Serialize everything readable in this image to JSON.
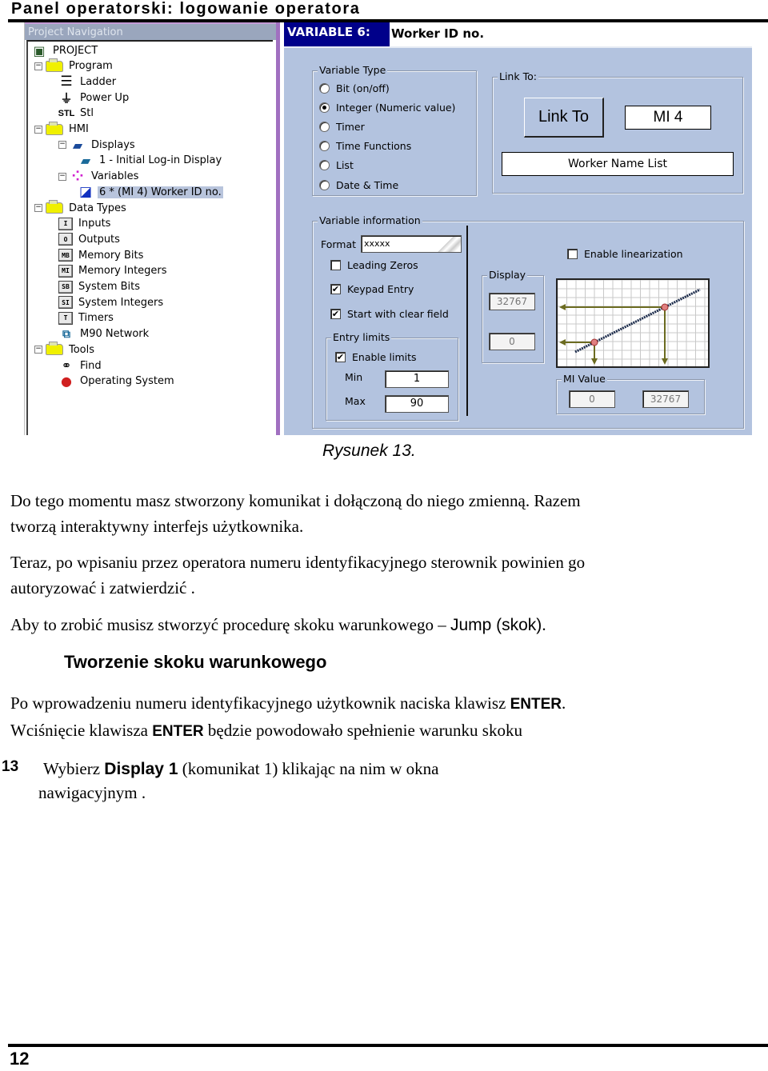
{
  "page": {
    "header": "Panel operatorski: logowanie operatora",
    "page_number": "12"
  },
  "screenshot": {
    "nav": {
      "title": "Project Navigation",
      "items": [
        {
          "label": "PROJECT",
          "icon": "plc-icon"
        },
        {
          "label": "Program",
          "icon": "folder-icon"
        },
        {
          "label": "Ladder",
          "icon": "ladder-icon"
        },
        {
          "label": "Power Up",
          "icon": "plug-icon"
        },
        {
          "label": "Stl",
          "icon": "stl-icon",
          "icon_text": "STL"
        },
        {
          "label": "HMI",
          "icon": "folder-icon"
        },
        {
          "label": "Displays",
          "icon": "displays-icon"
        },
        {
          "label": "1 - Initial Log-in Display",
          "icon": "display-icon"
        },
        {
          "label": "Variables",
          "icon": "variables-icon"
        },
        {
          "label": "6 * (MI 4) Worker ID no.",
          "icon": "variable-icon",
          "selected": true
        },
        {
          "label": "Data Types",
          "icon": "folder-icon"
        },
        {
          "label": "Inputs",
          "icon": "inputs-icon",
          "icon_text": "I"
        },
        {
          "label": "Outputs",
          "icon": "outputs-icon",
          "icon_text": "O"
        },
        {
          "label": "Memory Bits",
          "icon": "memory-bits-icon",
          "icon_text": "MB"
        },
        {
          "label": "Memory Integers",
          "icon": "memory-integers-icon",
          "icon_text": "MI"
        },
        {
          "label": "System Bits",
          "icon": "system-bits-icon",
          "icon_text": "SB"
        },
        {
          "label": "System Integers",
          "icon": "system-integers-icon",
          "icon_text": "SI"
        },
        {
          "label": "Timers",
          "icon": "timers-icon",
          "icon_text": "T"
        },
        {
          "label": "M90 Network",
          "icon": "network-icon"
        },
        {
          "label": "Tools",
          "icon": "folder-icon"
        },
        {
          "label": "Find",
          "icon": "binoculars-icon"
        },
        {
          "label": "Operating System",
          "icon": "os-icon"
        }
      ]
    },
    "dialog": {
      "variable_label": "VARIABLE 6:",
      "variable_name": "Worker ID no.",
      "variable_type": {
        "title": "Variable Type",
        "options": [
          {
            "label": "Bit (on/off)",
            "selected": false
          },
          {
            "label": "Integer (Numeric value)",
            "selected": true
          },
          {
            "label": "Timer",
            "selected": false
          },
          {
            "label": "Time Functions",
            "selected": false
          },
          {
            "label": "List",
            "selected": false
          },
          {
            "label": "Date & Time",
            "selected": false
          }
        ]
      },
      "link_to": {
        "title": "Link To:",
        "button": "Link To",
        "operand": "MI  4",
        "description": "Worker Name List"
      },
      "variable_info": {
        "title": "Variable information",
        "format_label": "Format",
        "format_value": "xxxxx",
        "leading_zeros": {
          "label": "Leading Zeros",
          "checked": false
        },
        "keypad_entry": {
          "label": "Keypad Entry",
          "checked": true
        },
        "start_clear": {
          "label": "Start with clear field",
          "checked": true
        },
        "entry_limits": {
          "title": "Entry limits",
          "enable": {
            "label": "Enable limits",
            "checked": true
          },
          "min_label": "Min",
          "min_value": "1",
          "max_label": "Max",
          "max_value": "90"
        },
        "display": {
          "title": "Display",
          "high": "32767",
          "low": "0"
        },
        "linearization": {
          "label": "Enable linearization",
          "checked": false
        },
        "mi_value": {
          "title": "MI Value",
          "low": "0",
          "high": "32767"
        }
      }
    }
  },
  "document": {
    "caption": "Rysunek 13.",
    "para1_line1": "Do tego momentu masz stworzony komunikat i dołączoną do niego zmienną. Razem",
    "para1_line2": "tworzą interaktywny interfejs użytkownika.",
    "para2_line1": "Teraz, po wpisaniu przez operatora numeru identyfikacyjnego sterownik powinien go",
    "para2_line2": "autoryzować i zatwierdzić .",
    "para3_prefix": "Aby to zrobić musisz stworzyć procedurę skoku warunkowego – ",
    "para3_sans": "Jump (skok)",
    "para3_suffix": ".",
    "heading": "Tworzenie skoku warunkowego",
    "para4_line1_prefix": "Po wprowadzeniu numeru identyfikacyjnego użytkownik naciska klawisz ",
    "para4_key": "ENTER",
    "para4_line1_suffix": ".",
    "para4_line2_prefix": "Wciśnięcie klawisza ",
    "para4_line2_suffix": " będzie powodowało spełnienie warunku skoku",
    "step": {
      "number": "13",
      "prefix": "Wybierz ",
      "bold": "Display 1",
      "suffix": " (komunikat 1) klikając na nim w okna",
      "line2": "nawigacyjnym ."
    }
  }
}
